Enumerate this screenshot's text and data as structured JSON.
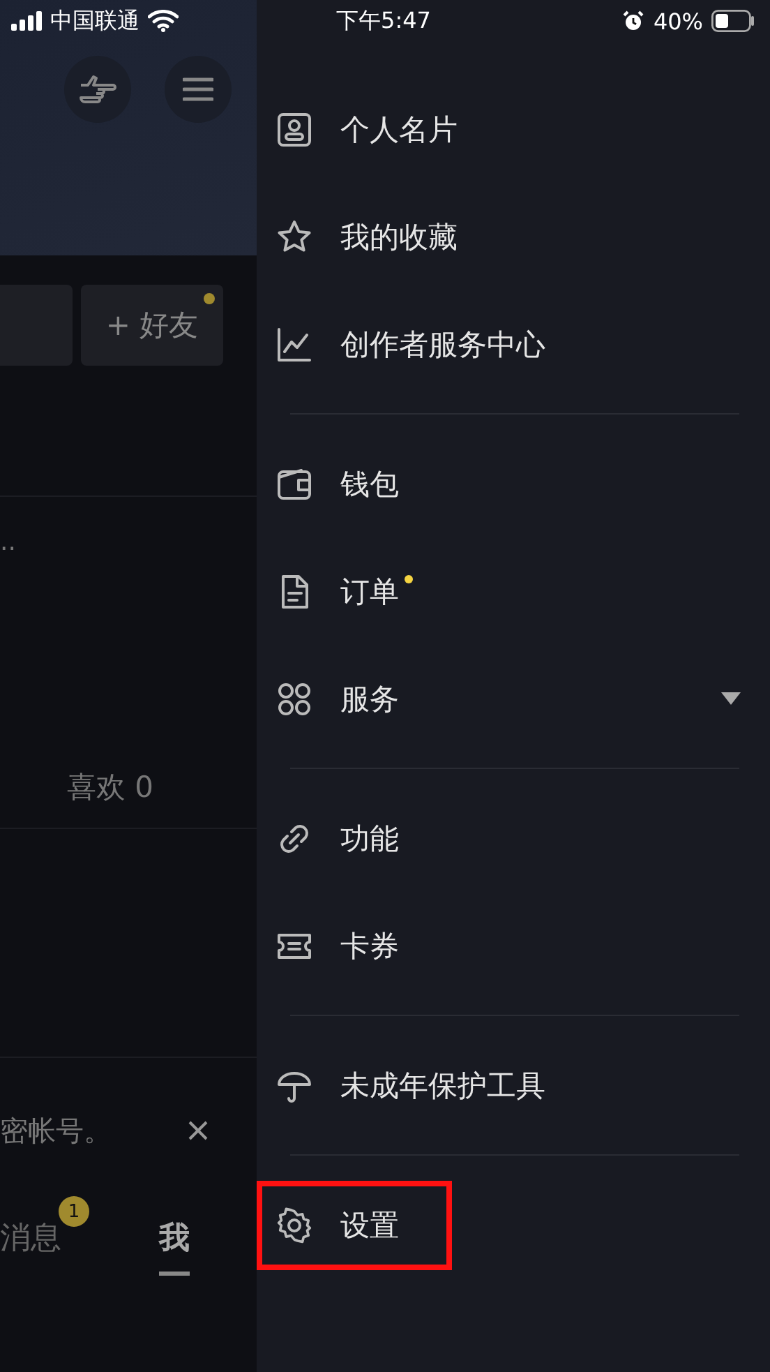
{
  "status_bar": {
    "carrier": "中国联通",
    "time": "下午5:47",
    "battery": "40%"
  },
  "background_page": {
    "add_friend_button": "+ 好友",
    "add_friend_dot": true,
    "ellipsis": "..",
    "likes": "喜欢 0",
    "notice": "密帐号。",
    "nav_tabs": [
      {
        "label": "消息",
        "badge": "1",
        "selected": false
      },
      {
        "label": "我",
        "selected": true
      }
    ]
  },
  "drawer": {
    "sections": [
      [
        {
          "label": "个人名片",
          "kind": "link",
          "dot": false,
          "highlighted": false
        },
        {
          "label": "我的收藏",
          "kind": "link",
          "dot": false,
          "highlighted": false
        },
        {
          "label": "创作者服务中心",
          "kind": "link",
          "dot": false,
          "highlighted": false
        }
      ],
      [
        {
          "label": "钱包",
          "kind": "link",
          "dot": false,
          "highlighted": false
        },
        {
          "label": "订单",
          "kind": "link",
          "dot": true,
          "highlighted": false
        },
        {
          "label": "服务",
          "kind": "expandable",
          "dot": false,
          "highlighted": false
        }
      ],
      [
        {
          "label": "功能",
          "kind": "link",
          "dot": false,
          "highlighted": false
        },
        {
          "label": "卡券",
          "kind": "link",
          "dot": false,
          "highlighted": false
        }
      ],
      [
        {
          "label": "未成年保护工具",
          "kind": "link",
          "dot": false,
          "highlighted": false
        }
      ],
      [
        {
          "label": "设置",
          "kind": "link",
          "dot": false,
          "highlighted": true
        }
      ]
    ]
  }
}
